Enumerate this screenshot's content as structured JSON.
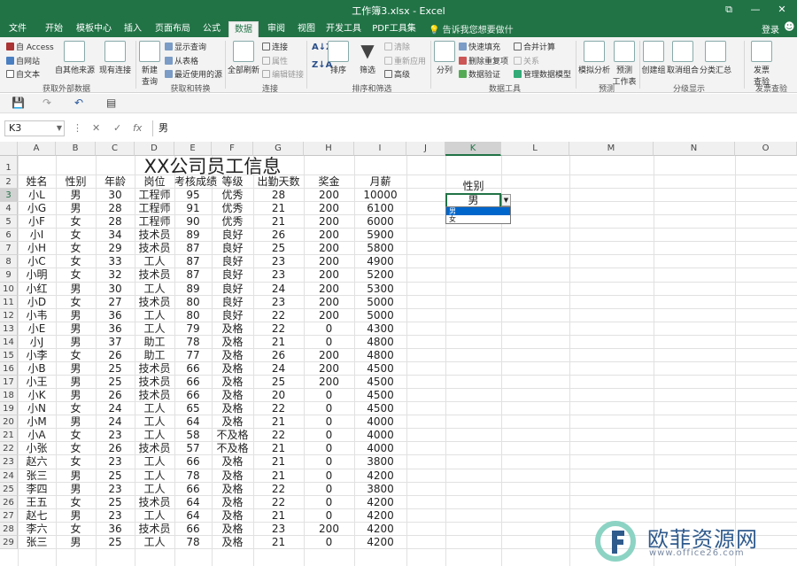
{
  "window": {
    "title": "工作簿3.xlsx - Excel",
    "restore": "⧉",
    "min": "—",
    "close": "✕"
  },
  "tabs": [
    {
      "label": "文件"
    },
    {
      "label": "开始"
    },
    {
      "label": "模板中心"
    },
    {
      "label": "插入"
    },
    {
      "label": "页面布局"
    },
    {
      "label": "公式"
    },
    {
      "label": "数据",
      "active": true
    },
    {
      "label": "审阅"
    },
    {
      "label": "视图"
    },
    {
      "label": "开发工具"
    },
    {
      "label": "PDF工具集"
    }
  ],
  "tell_me": "告诉我您想要做什么...",
  "login": "登录",
  "ribbon": {
    "access": "自 Access",
    "web": "自网站",
    "text": "自文本",
    "other_sources": "自其他来源",
    "existing": "现有连接",
    "new_query": "新建\n查询",
    "show_query": "显示查询",
    "from_table": "从表格",
    "recent": "最近使用的源",
    "refresh_all": "全部刷新",
    "connections": "连接",
    "properties": "属性",
    "edit_links": "编辑链接",
    "sort": "排序",
    "filter": "筛选",
    "clear": "清除",
    "reapply": "重新应用",
    "advanced": "高级",
    "split": "分列",
    "flash_fill": "快速填充",
    "remove_dup": "删除重复项",
    "validation": "数据验证",
    "consolidate": "合并计算",
    "relations": "关系",
    "data_model": "管理数据模型",
    "what_if": "模拟分析",
    "forecast": "预测\n工作表",
    "group": "创建组",
    "ungroup": "取消组合",
    "subtotal": "分类汇总",
    "invoice": "发票\n查验",
    "groups": {
      "external": "获取外部数据",
      "transform": "获取和转换",
      "connections": "连接",
      "sort_filter": "排序和筛选",
      "data_tools": "数据工具",
      "forecast": "预测",
      "outline": "分级显示",
      "invoice": "发票查验"
    }
  },
  "formula_bar": {
    "namebox": "K3",
    "cancel": "✕",
    "enter": "✓",
    "fx": "fx",
    "value": "男"
  },
  "columns": [
    "A",
    "B",
    "C",
    "D",
    "E",
    "F",
    "G",
    "H",
    "I",
    "J",
    "K",
    "L",
    "M",
    "N",
    "O"
  ],
  "rows": [
    "1",
    "2",
    "3",
    "4",
    "5",
    "6",
    "7",
    "8",
    "9",
    "10",
    "11",
    "12",
    "13",
    "14",
    "15",
    "16",
    "17",
    "18",
    "19",
    "20",
    "21",
    "22",
    "23",
    "24",
    "25",
    "26",
    "27",
    "28",
    "29"
  ],
  "sheet_title": "XX公司员工信息",
  "headers": [
    "姓名",
    "性别",
    "年龄",
    "岗位",
    "考核成绩",
    "等级",
    "出勤天数",
    "奖金",
    "月薪"
  ],
  "data": [
    [
      "小L",
      "男",
      "30",
      "工程师",
      "95",
      "优秀",
      "28",
      "200",
      "10000"
    ],
    [
      "小G",
      "男",
      "28",
      "工程师",
      "91",
      "优秀",
      "21",
      "200",
      "6100"
    ],
    [
      "小F",
      "女",
      "28",
      "工程师",
      "90",
      "优秀",
      "21",
      "200",
      "6000"
    ],
    [
      "小I",
      "女",
      "34",
      "技术员",
      "89",
      "良好",
      "26",
      "200",
      "5900"
    ],
    [
      "小H",
      "女",
      "29",
      "技术员",
      "87",
      "良好",
      "25",
      "200",
      "5800"
    ],
    [
      "小C",
      "女",
      "33",
      "工人",
      "87",
      "良好",
      "23",
      "200",
      "4900"
    ],
    [
      "小明",
      "女",
      "32",
      "技术员",
      "87",
      "良好",
      "23",
      "200",
      "5200"
    ],
    [
      "小红",
      "男",
      "30",
      "工人",
      "89",
      "良好",
      "24",
      "200",
      "5300"
    ],
    [
      "小D",
      "女",
      "27",
      "技术员",
      "80",
      "良好",
      "23",
      "200",
      "5000"
    ],
    [
      "小韦",
      "男",
      "36",
      "工人",
      "80",
      "良好",
      "22",
      "200",
      "5000"
    ],
    [
      "小E",
      "男",
      "36",
      "工人",
      "79",
      "及格",
      "22",
      "0",
      "4300"
    ],
    [
      "小J",
      "男",
      "37",
      "助工",
      "78",
      "及格",
      "21",
      "0",
      "4800"
    ],
    [
      "小李",
      "女",
      "26",
      "助工",
      "77",
      "及格",
      "26",
      "200",
      "4800"
    ],
    [
      "小B",
      "男",
      "25",
      "技术员",
      "66",
      "及格",
      "24",
      "200",
      "4500"
    ],
    [
      "小王",
      "男",
      "25",
      "技术员",
      "66",
      "及格",
      "25",
      "200",
      "4500"
    ],
    [
      "小K",
      "男",
      "26",
      "技术员",
      "66",
      "及格",
      "20",
      "0",
      "4500"
    ],
    [
      "小N",
      "女",
      "24",
      "工人",
      "65",
      "及格",
      "22",
      "0",
      "4500"
    ],
    [
      "小M",
      "男",
      "24",
      "工人",
      "64",
      "及格",
      "21",
      "0",
      "4000"
    ],
    [
      "小A",
      "女",
      "23",
      "工人",
      "58",
      "不及格",
      "22",
      "0",
      "4000"
    ],
    [
      "小张",
      "女",
      "26",
      "技术员",
      "57",
      "不及格",
      "21",
      "0",
      "4000"
    ],
    [
      "赵六",
      "女",
      "23",
      "工人",
      "66",
      "及格",
      "21",
      "0",
      "3800"
    ],
    [
      "张三",
      "男",
      "25",
      "工人",
      "78",
      "及格",
      "21",
      "0",
      "4200"
    ],
    [
      "李四",
      "男",
      "23",
      "工人",
      "66",
      "及格",
      "22",
      "0",
      "3800"
    ],
    [
      "王五",
      "女",
      "25",
      "技术员",
      "64",
      "及格",
      "22",
      "0",
      "4200"
    ],
    [
      "赵七",
      "男",
      "23",
      "工人",
      "64",
      "及格",
      "21",
      "0",
      "4200"
    ],
    [
      "李六",
      "女",
      "36",
      "技术员",
      "66",
      "及格",
      "23",
      "200",
      "4200"
    ],
    [
      "张三",
      "男",
      "25",
      "工人",
      "78",
      "及格",
      "21",
      "0",
      "4200"
    ]
  ],
  "side_label": "性别",
  "selected_value": "男",
  "dropdown_options": [
    "男",
    "女"
  ],
  "watermark": {
    "text": "欧菲资源网",
    "url": "www.office26.com"
  }
}
